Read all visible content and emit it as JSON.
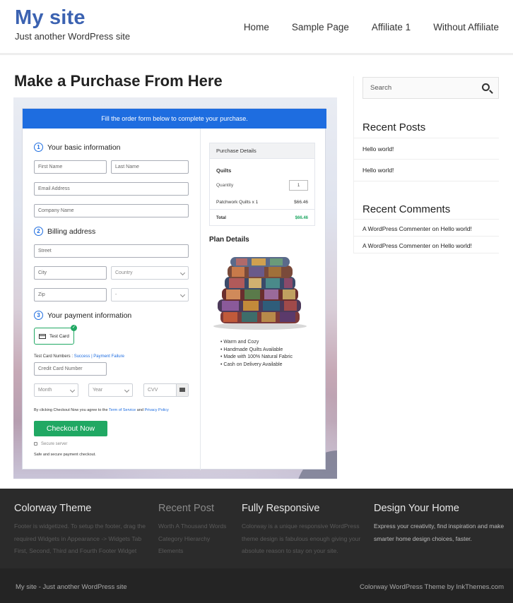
{
  "header": {
    "site_title": "My site",
    "site_description": "Just another WordPress site",
    "nav": [
      "Home",
      "Sample Page",
      "Affiliate 1",
      "Without Affiliate"
    ]
  },
  "main": {
    "page_title": "Make a Purchase From Here",
    "banner": "Fill the order form below to complete your purchase.",
    "steps": [
      {
        "num": "1",
        "label": "Your basic information"
      },
      {
        "num": "2",
        "label": "Billing address"
      },
      {
        "num": "3",
        "label": "Your payment information"
      }
    ],
    "fields": {
      "first_name": "First Name",
      "last_name": "Last Name",
      "email": "Email Address",
      "company": "Company Name",
      "street": "Street",
      "city": "City",
      "country": "Country",
      "zip": "Zip",
      "state": "-",
      "card_number": "Credit Card Number",
      "month": "Month",
      "year": "Year",
      "cvv": "CVV"
    },
    "test_card_label": "Test Card",
    "test_card_numbers_label": "Test Card Numbers :",
    "success_link": "Success",
    "separator": "|",
    "failure_link": "Payment Failure",
    "terms_prefix": "By clicking Checkout Now you agree to the",
    "terms_link": "Term of Service",
    "terms_and": "and",
    "privacy_link": "Privacy Policy",
    "checkout_button": "Checkout Now",
    "secure_server": "Secure server",
    "safe_text": "Safe and secure payment checkout.",
    "purchase_details": {
      "heading": "Purchase Details",
      "product": "Quilts",
      "quantity_label": "Quantity",
      "quantity_value": "1",
      "line_item": "Patchwork Quilts x 1",
      "line_price": "$66.46",
      "total_label": "Total",
      "total_value": "$66.46"
    },
    "plan_details": {
      "heading": "Plan Details",
      "features": [
        "Warm and Cozy",
        "Handmade Quilts Available",
        "Made with 100% Natural Fabric",
        "Cash on Delivery Available"
      ]
    }
  },
  "sidebar": {
    "search_placeholder": "Search",
    "recent_posts_title": "Recent Posts",
    "recent_posts": [
      "Hello world!",
      "Hello world!"
    ],
    "recent_comments_title": "Recent Comments",
    "recent_comments": [
      {
        "author": "A WordPress Commenter",
        "on": "on",
        "post": "Hello world!"
      },
      {
        "author": "A WordPress Commenter",
        "on": "on",
        "post": "Hello world!"
      }
    ]
  },
  "footer": {
    "col1_title": "Colorway Theme",
    "col1_text": "Footer is widgetized. To setup the footer, drag the required Widgets in Appearance -> Widgets Tab First, Second, Third and Fourth Footer Widget",
    "col2_title": "Recent Post",
    "col2_items": [
      "Worth A Thousand Words",
      "Category Hierarchy",
      "Elements"
    ],
    "col3_title": "Fully Responsive",
    "col3_text": "Colorway is a unique responsive WordPress theme design is fabulous enough giving your absolute reason to stay on your site.",
    "col4_title": "Design Your Home",
    "col4_text": "Express your creativity, find inspiration and make smarter home design choices, faster.",
    "bottom_left": "My site - Just another WordPress site",
    "bottom_right": "Colorway WordPress Theme by InkThemes.com"
  },
  "colors": {
    "accent_blue": "#1e6de0",
    "title_blue": "#3b62b1",
    "green": "#20a863",
    "footer_bg": "#2b2b2b"
  }
}
